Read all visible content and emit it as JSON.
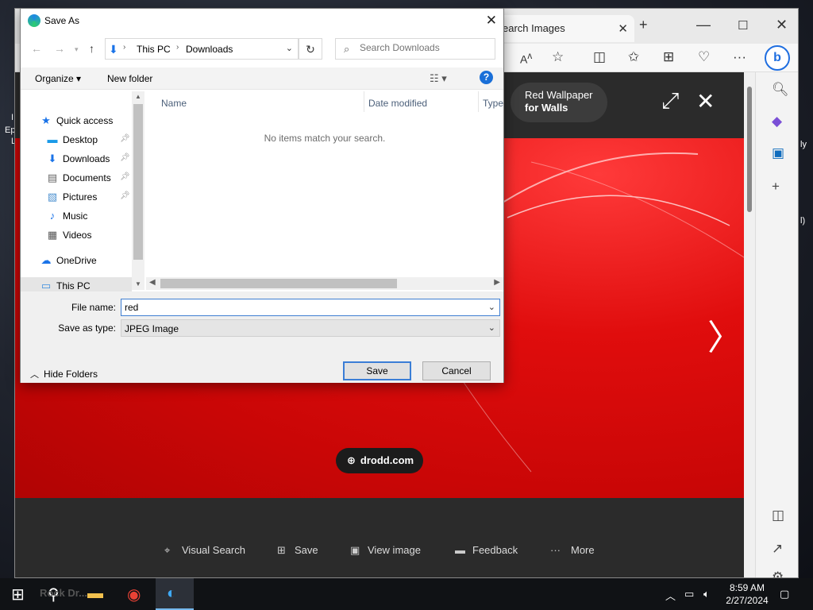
{
  "desktop": {
    "fragments": [
      "I",
      "Ep",
      "L",
      "ly",
      "l)"
    ]
  },
  "edge": {
    "tab_title": "earch Images",
    "caption_line1": "Red Wallpaper",
    "caption_line2": "for Walls",
    "source": "drodd.com",
    "actions": {
      "visual_search": "Visual Search",
      "save": "Save",
      "view_image": "View image",
      "feedback": "Feedback",
      "more": "More"
    },
    "bing_letter": "b"
  },
  "dialog": {
    "title": "Save As",
    "breadcrumb": [
      "This PC",
      "Downloads"
    ],
    "search_placeholder": "Search Downloads",
    "organize": "Organize ▾",
    "new_folder": "New folder",
    "help": "?",
    "nav": {
      "quick_access": "Quick access",
      "desktop": "Desktop",
      "downloads": "Downloads",
      "documents": "Documents",
      "pictures": "Pictures",
      "music": "Music",
      "videos": "Videos",
      "onedrive": "OneDrive",
      "this_pc": "This PC"
    },
    "columns": {
      "name": "Name",
      "date_modified": "Date modified",
      "type": "Type"
    },
    "empty_message": "No items match your search.",
    "file_name_label": "File name:",
    "file_name_value": "red",
    "save_as_type_label": "Save as type:",
    "save_as_type_value": "JPEG Image",
    "hide_folders": "Hide Folders",
    "save_button": "Save",
    "cancel_button": "Cancel"
  },
  "taskbar": {
    "time": "8:59 AM",
    "date": "2/27/2024",
    "faded_label": "Rock Dr..."
  },
  "colors": {
    "accent": "#3b7ed6",
    "image_red": "#e00d0d",
    "edge_blue": "#1f6ee0"
  }
}
